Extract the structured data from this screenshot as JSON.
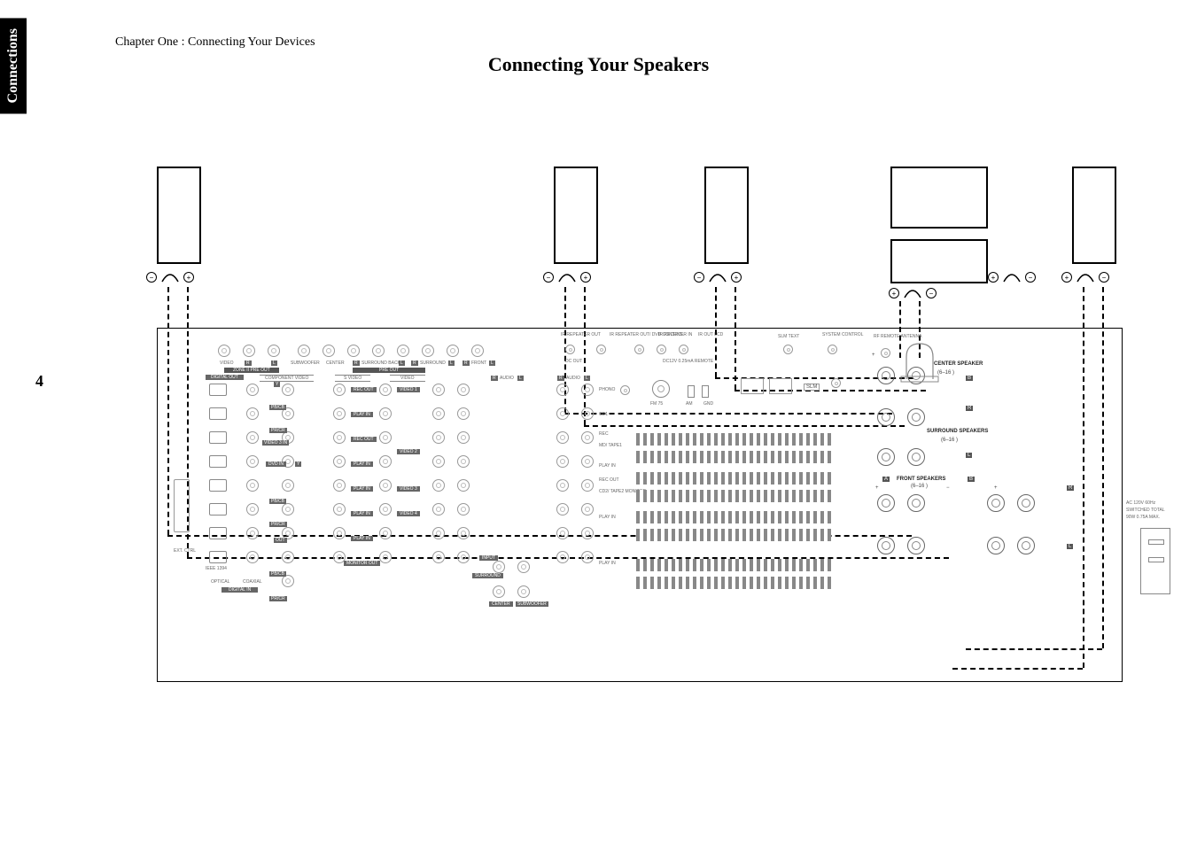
{
  "sidebar": {
    "tab": "Connections"
  },
  "header": {
    "chapter_line": "Chapter One : Connecting Your Devices"
  },
  "title": "Connecting Your Speakers",
  "page_number": "4",
  "speaker_terminals": {
    "minus": "−",
    "plus": "+"
  },
  "panel": {
    "top_row": {
      "ir_repeater_out": "IR REPEATER OUT",
      "ir_repeater_out_dvd": "IR REPEATER OUT/\nDVD CONTROL",
      "ir_receiver_in": "IR RECEIVER IN",
      "ir_out_lcd": "IR OUT LCD",
      "slm_text": "SLM TEXT",
      "system_control": "SYSTEM CONTROL",
      "rf_remote_antenna": "RF REMOTE ANTENNA",
      "dc_out": "DC OUT",
      "dc_remote": "DC12V 0.25mA REMOTE"
    },
    "zone2": {
      "heading": "ZONE II PRE OUT",
      "video": "VIDEO",
      "r": "R",
      "l": "L"
    },
    "preout": {
      "heading": "PRE OUT",
      "subwoofer": "SUBWOOFER",
      "center": "CENTER",
      "surround_back_r": "SURROUND BACK",
      "surround_r": "SURROUND",
      "front_r": "FRONT"
    },
    "digital_out": "DIGITAL OUT",
    "component_video": "COMPONENT VIDEO",
    "svideo": "S VIDEO",
    "video_col": "VIDEO",
    "audio_lr": {
      "r": "R",
      "l": "L",
      "audio": "AUDIO"
    },
    "video_inputs": {
      "video3_in": "VIDEO 3 IN",
      "dvd_in": "DVD IN",
      "y": "Y",
      "pb": "PB/CB",
      "pr": "PR/CR",
      "out": "OUT"
    },
    "row_labels": {
      "rec_out": "REC OUT",
      "play_in": "PLAY IN",
      "monitor_out": "MONITOR OUT",
      "video1": "VIDEO 1",
      "video2": "VIDEO 2",
      "video3": "VIDEO 3",
      "video4": "VIDEO 4"
    },
    "right_small": {
      "phono": "PHONO",
      "cd1": "CD1",
      "rec": "REC",
      "md_tape1": "MD/\nTAPE1",
      "cd2_tape2": "CD2/\nTAPE2\nMONITOR",
      "play_in": "PLAY IN",
      "input": "INPUT",
      "surround": "SURROUND",
      "center": "CENTER",
      "subwoofer": "SUBWOOFER"
    },
    "antenna": {
      "fm75": "FM 75",
      "am": "AM",
      "gnd": "GND"
    },
    "speakers_block": {
      "center": "CENTER SPEAKER",
      "impedance": "(6–16   )",
      "surround": "SURROUND SPEAKERS",
      "front": "FRONT SPEAKERS",
      "a": "A",
      "b": "B",
      "r": "R",
      "l": "L",
      "plus": "+",
      "minus": "−"
    },
    "ac": {
      "line1": "AC 120V  60Hz",
      "line2": "SWITCHED  TOTAL",
      "line3": "90W 0.75A MAX."
    },
    "slm": "SLM",
    "digital_in": {
      "optical": "OPTICAL",
      "coaxial": "COAXIAL",
      "heading": "DIGITAL IN"
    },
    "ext_ctrl": "EXT. CTRL",
    "ieee": "IEEE 1394"
  }
}
